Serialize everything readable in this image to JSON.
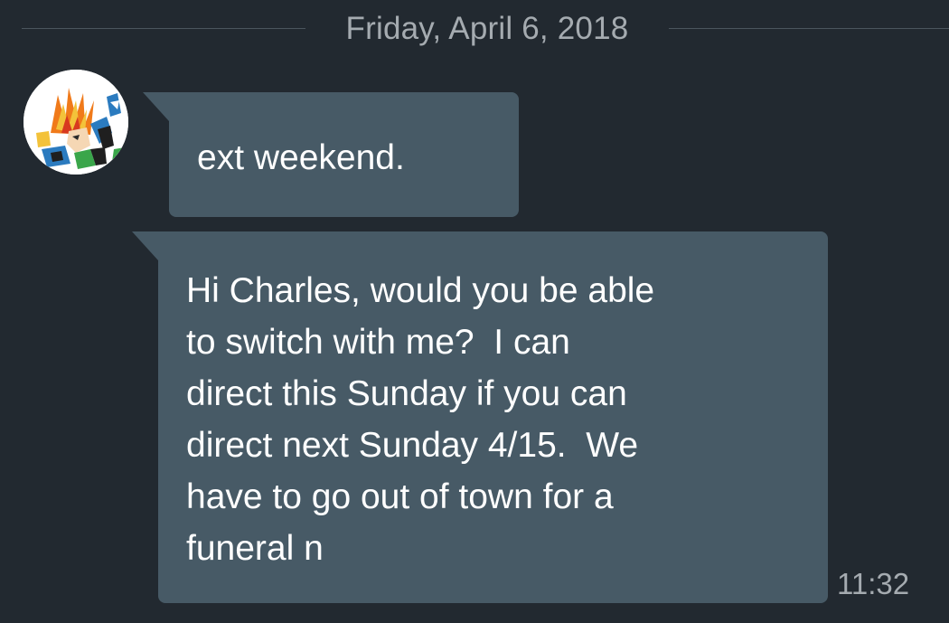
{
  "date_divider": {
    "label": "Friday, April 6, 2018"
  },
  "contact": {
    "avatar_icon": "anime-character-avatar-icon"
  },
  "messages": [
    {
      "text": "ext weekend."
    },
    {
      "text": "Hi Charles, would you be able\nto switch with me?  I can\ndirect this Sunday if you can\ndirect next Sunday 4/15.  We\nhave to go out of town for a\nfuneral n",
      "time": "11:32"
    }
  ],
  "colors": {
    "background": "#222930",
    "bubble": "#475a66",
    "secondary_text": "#a5abb0",
    "message_text": "#ffffff"
  }
}
